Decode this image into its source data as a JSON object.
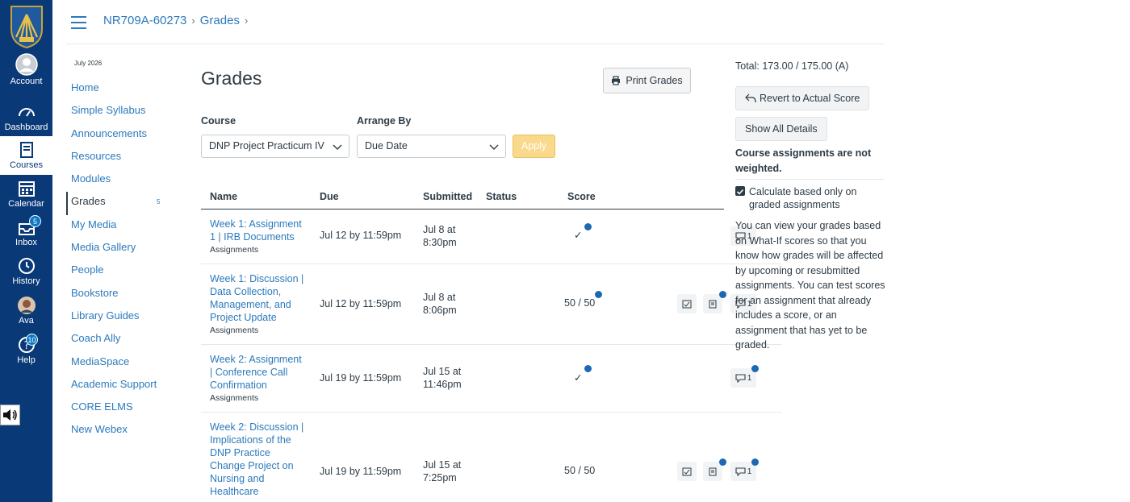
{
  "global_nav": {
    "items": [
      {
        "label": "Account",
        "icon": "account-avatar-icon"
      },
      {
        "label": "Dashboard",
        "icon": "dashboard-icon"
      },
      {
        "label": "Courses",
        "icon": "courses-icon",
        "active": true
      },
      {
        "label": "Calendar",
        "icon": "calendar-icon"
      },
      {
        "label": "Inbox",
        "icon": "inbox-icon",
        "badge": "5"
      },
      {
        "label": "History",
        "icon": "history-icon"
      },
      {
        "label": "Ava",
        "icon": "user-avatar-icon"
      },
      {
        "label": "Help",
        "icon": "help-icon",
        "badge": "10"
      }
    ]
  },
  "breadcrumb": {
    "course": "NR709A-60273",
    "page": "Grades"
  },
  "course_nav": {
    "term": "July 2026",
    "items": [
      {
        "label": "Home"
      },
      {
        "label": "Simple Syllabus"
      },
      {
        "label": "Announcements"
      },
      {
        "label": "Resources"
      },
      {
        "label": "Modules"
      },
      {
        "label": "Grades",
        "active": true,
        "count": "5"
      },
      {
        "label": "My Media"
      },
      {
        "label": "Media Gallery"
      },
      {
        "label": "People"
      },
      {
        "label": "Bookstore"
      },
      {
        "label": "Library Guides"
      },
      {
        "label": "Coach Ally"
      },
      {
        "label": "MediaSpace"
      },
      {
        "label": "Academic Support"
      },
      {
        "label": "CORE ELMS"
      },
      {
        "label": "New Webex"
      }
    ]
  },
  "main": {
    "title": "Grades",
    "print_label": "Print Grades",
    "course_label": "Course",
    "course_value": "DNP Project  Practicum IV",
    "arrange_label": "Arrange By",
    "arrange_value": "Due Date",
    "apply_label": "Apply"
  },
  "table": {
    "headers": {
      "name": "Name",
      "due": "Due",
      "submitted": "Submitted",
      "status": "Status",
      "score": "Score"
    },
    "rows": [
      {
        "name": "Week 1: Assignment 1 | IRB Documents",
        "group": "Assignments",
        "due": "Jul 12 by 11:59pm",
        "submitted": "Jul 8 at 8:30pm",
        "score": "✓",
        "comments": "1"
      },
      {
        "name": "Week 1: Discussion | Data Collection, Management, and Project Update",
        "group": "Assignments",
        "due": "Jul 12 by 11:59pm",
        "submitted": "Jul 8 at 8:06pm",
        "score": "50 / 50",
        "comments": "1"
      },
      {
        "name": "Week 2: Assignment | Conference Call Confirmation",
        "group": "Assignments",
        "due": "Jul 19 by 11:59pm",
        "submitted": "Jul 15 at 11:46pm",
        "score": "✓",
        "comments": "1"
      },
      {
        "name": "Week 2: Discussion | Implications of the DNP Practice Change Project on Nursing and Healthcare",
        "group": "",
        "due": "Jul 19 by 11:59pm",
        "submitted": "Jul 15 at 7:25pm",
        "score": "50 / 50",
        "comments": "1"
      }
    ]
  },
  "sidebar": {
    "total": "Total: 173.00 / 175.00 (A)",
    "revert_label": "Revert to Actual Score",
    "show_details_label": "Show All Details",
    "not_weighted": "Course assignments are not weighted.",
    "calc_label": "Calculate based only on graded assignments",
    "whatif_text": "You can view your grades based on What-If scores so that you know how grades will be affected by upcoming or resubmitted assignments. You can test scores for an assignment that already includes a score, or an assignment that has yet to be graded."
  },
  "colors": {
    "nav_bg": "#0a3977",
    "link": "#2b7abc",
    "text": "#2d3b45",
    "apply_disabled": "#f9d98c",
    "unread_dot": "#1d68b3"
  }
}
